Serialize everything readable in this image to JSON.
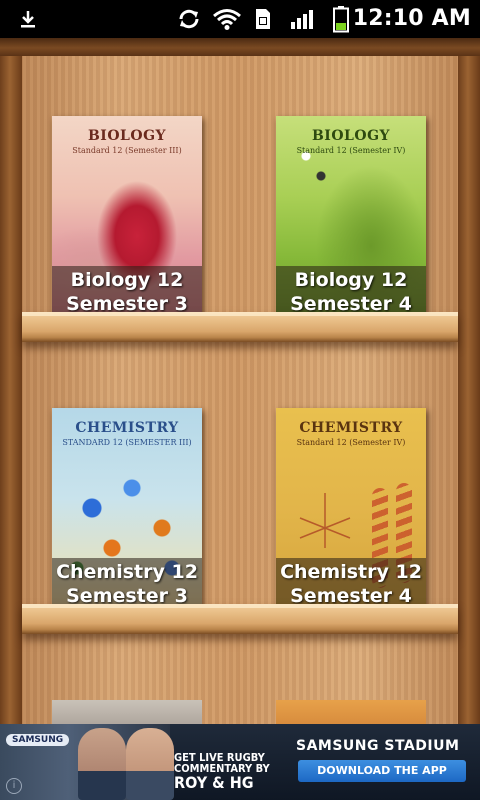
{
  "status_bar": {
    "time": "12:10 AM",
    "icons": [
      "download-icon",
      "sync-icon",
      "wifi-icon",
      "sim-icon",
      "signal-icon",
      "battery-icon"
    ],
    "battery_color": "#7cd31e"
  },
  "bookshelf": {
    "books": [
      {
        "title_line1": "Biology 12",
        "title_line2": "Semester 3",
        "cover_title": "BIOLOGY",
        "cover_sub": "Standard 12 (Semester III)"
      },
      {
        "title_line1": "Biology 12",
        "title_line2": "Semester 4",
        "cover_title": "BIOLOGY",
        "cover_sub": "Standard 12 (Semester IV)"
      },
      {
        "title_line1": "Chemistry 12",
        "title_line2": "Semester 3",
        "cover_title": "CHEMISTRY",
        "cover_sub": "STANDARD 12 (SEMESTER III)"
      },
      {
        "title_line1": "Chemistry 12",
        "title_line2": "Semester 4",
        "cover_title": "CHEMISTRY",
        "cover_sub": "Standard 12 (Semester IV)"
      }
    ]
  },
  "ad": {
    "brand": "SAMSUNG",
    "promo_line1": "GET LIVE RUGBY",
    "promo_line2": "COMMENTARY BY",
    "promo_line3": "ROY & HG",
    "stadium": "SAMSUNG STADIUM",
    "cta": "DOWNLOAD THE APP",
    "info_icon": "i"
  }
}
